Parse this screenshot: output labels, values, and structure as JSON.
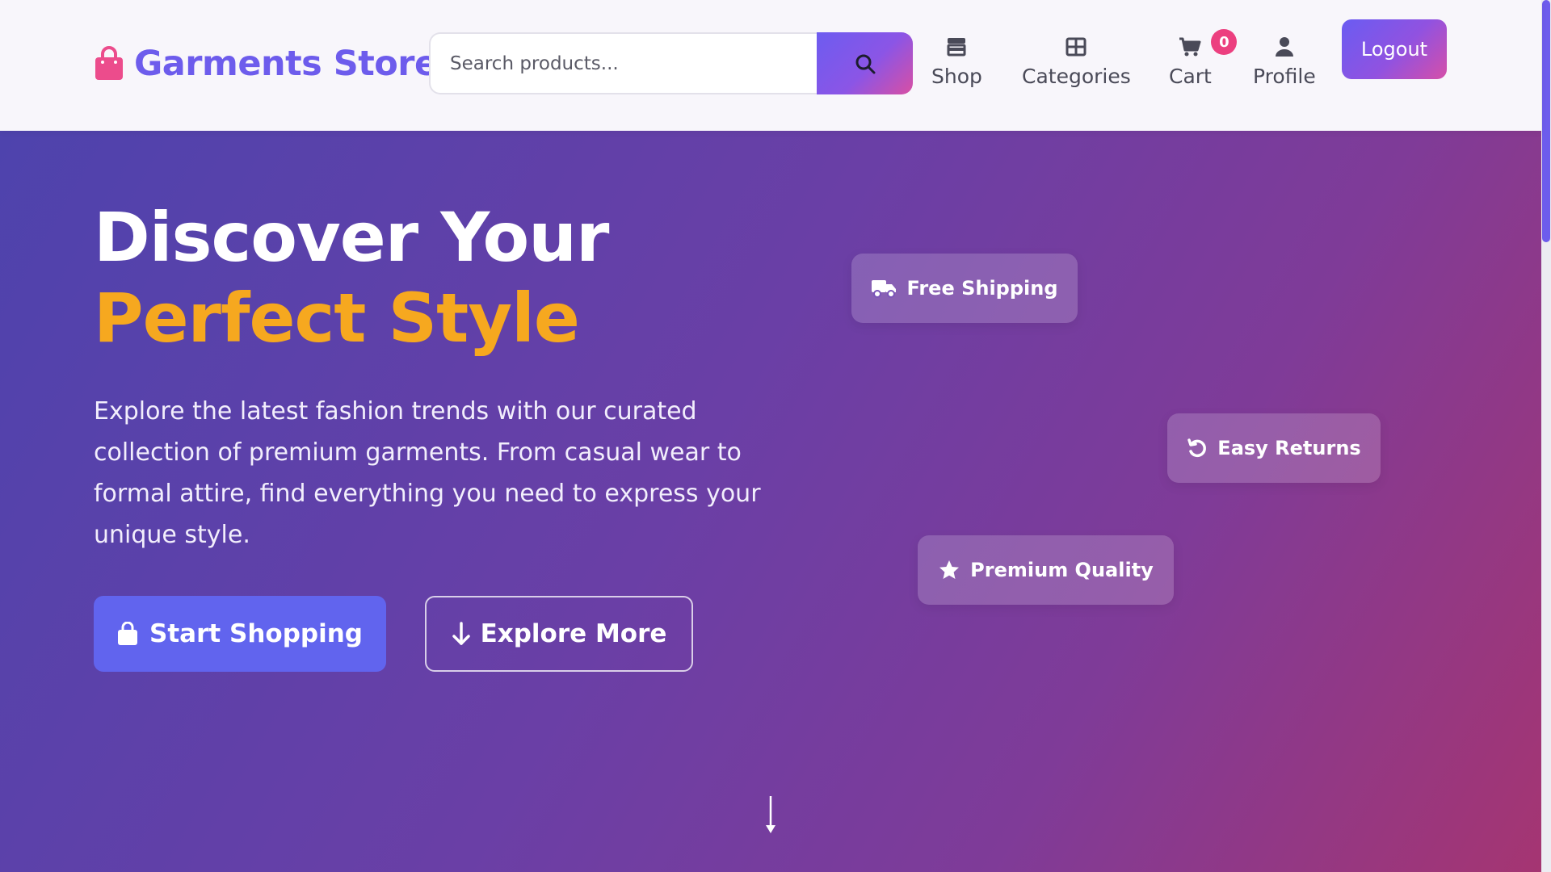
{
  "brand": {
    "name": "Garments Store",
    "icon": "shopping-bag-icon",
    "color": "#6d5cec"
  },
  "search": {
    "placeholder": "Search products...",
    "button_icon": "search-icon"
  },
  "nav": {
    "items": [
      {
        "label": "Shop",
        "icon": "store-icon"
      },
      {
        "label": "Categories",
        "icon": "grid-icon"
      },
      {
        "label": "Cart",
        "icon": "cart-icon",
        "badge": "0"
      },
      {
        "label": "Profile",
        "icon": "user-icon"
      }
    ],
    "logout": "Logout"
  },
  "hero": {
    "title_line1": "Discover Your",
    "title_line2": "Perfect Style",
    "description": "Explore the latest fashion trends with our curated collection of premium garments. From casual wear to formal attire, find everything you need to express your unique style.",
    "primary_button": "Start Shopping",
    "secondary_button": "Explore More",
    "features": [
      {
        "label": "Free Shipping",
        "icon": "truck-icon"
      },
      {
        "label": "Easy Returns",
        "icon": "undo-icon"
      },
      {
        "label": "Premium Quality",
        "icon": "star-icon"
      }
    ],
    "scroll_icon": "arrow-down-icon"
  },
  "colors": {
    "accent": "#6d5cec",
    "highlight": "#f6a81f",
    "badge": "#ec3f7f",
    "primary_button": "#6164ee"
  }
}
